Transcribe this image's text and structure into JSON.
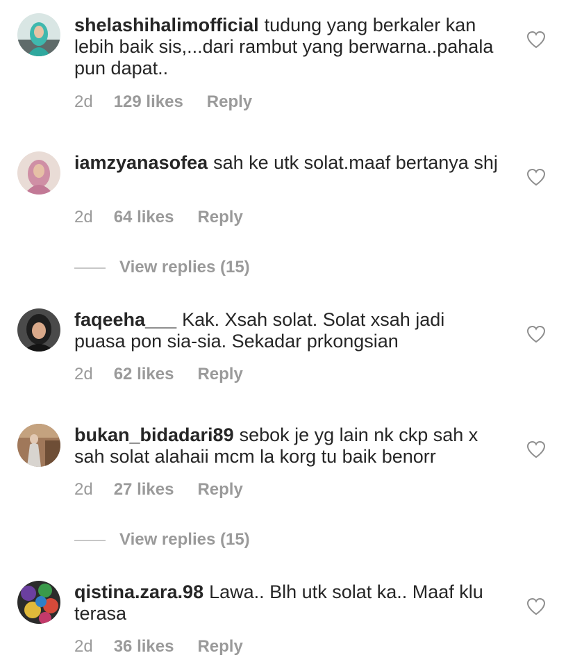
{
  "comments": [
    {
      "username": "shelashihalimofficial",
      "text": "tudung yang berkaler kan lebih baik sis,...dari rambut yang berwarna..pahala pun dapat..",
      "time": "2d",
      "likes": "129 likes",
      "reply": "Reply"
    },
    {
      "username": "iamzyanasofea",
      "text": "sah ke utk solat.maaf bertanya shj",
      "time": "2d",
      "likes": "64 likes",
      "reply": "Reply",
      "view_replies": "View replies (15)"
    },
    {
      "username": "faqeeha___",
      "text": "Kak. Xsah solat. Solat xsah jadi puasa pon sia-sia. Sekadar prkongsian",
      "time": "2d",
      "likes": "62 likes",
      "reply": "Reply"
    },
    {
      "username": "bukan_bidadari89",
      "text": "sebok je yg lain nk ckp sah x sah solat alahaii mcm la korg tu baik benorr",
      "time": "2d",
      "likes": "27 likes",
      "reply": "Reply",
      "view_replies": "View replies (15)"
    },
    {
      "username": "qistina.zara.98",
      "text": "Lawa.. Blh utk solat ka.. Maaf klu terasa",
      "time": "2d",
      "likes": "36 likes",
      "reply": "Reply"
    }
  ],
  "icons": {
    "like": "heart-outline-icon"
  },
  "colors": {
    "text": "#262626",
    "secondary": "#9a9a9a",
    "divider": "#c7c7c7"
  }
}
